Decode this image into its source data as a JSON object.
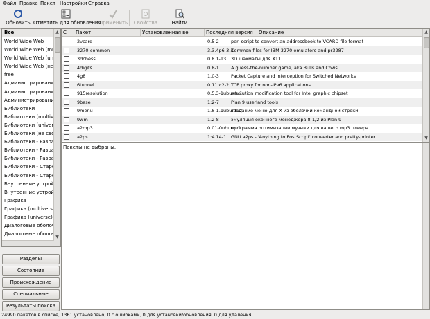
{
  "menu": [
    "Файл",
    "Правка",
    "Пакет",
    "Настройки",
    "Справка"
  ],
  "toolbar": {
    "reload": "Обновить",
    "mark_all_upgrades": "Отметить для обновления",
    "apply": "Применить",
    "properties": "Свойства",
    "search": "Найти"
  },
  "sections": {
    "header": "Все",
    "items": [
      "World Wide Web",
      "World Wide Web (multiv",
      "World Wide Web (univer",
      "World Wide Web (не сво",
      "free",
      "Администрирование",
      "Администрирование",
      "Администрирование",
      "Библиотеки",
      "Библиотеки (multiverse",
      "Библиотеки (universe",
      "Библиотеки (не свобо",
      "Библиотеки - Разрабо",
      "Библиотеки - Разрабо",
      "Библиотеки - Разрабо",
      "Библиотеки - Старое",
      "Библиотеки - Старое",
      "Внутренние устройст",
      "Внутренние устройст",
      "Графика",
      "Графика (multiverse)",
      "Графика (universe)",
      "Диалоговые оболочк",
      "Диалоговые оболочк",
      "Документация"
    ]
  },
  "filter_buttons": [
    "Разделы",
    "Состояние",
    "Происхождение",
    "Специальные фильтры",
    "Результаты поиска"
  ],
  "table": {
    "columns": [
      "С",
      "Пакет",
      "Установленная ве",
      "Последняя версия",
      "Описание"
    ],
    "rows": [
      {
        "name": "2vcard",
        "installed": "",
        "latest": "0.5-2",
        "description": "perl script to convert an addressbook to VCARD file format"
      },
      {
        "name": "3270-common",
        "installed": "",
        "latest": "3.3.4p6-3.3",
        "description": "Common files for IBM 3270 emulators and pr3287"
      },
      {
        "name": "3dchess",
        "installed": "",
        "latest": "0.8.1-13",
        "description": "3D шахматы для X11"
      },
      {
        "name": "4digits",
        "installed": "",
        "latest": "0.8-1",
        "description": "A guess-the-number game, aka Bulls and Cows"
      },
      {
        "name": "4g8",
        "installed": "",
        "latest": "1.0-3",
        "description": "Packet Capture and Interception for Switched Networks"
      },
      {
        "name": "6tunnel",
        "installed": "",
        "latest": "0.11rc2-2",
        "description": "TCP proxy for non-IPv6 applications"
      },
      {
        "name": "915resolution",
        "installed": "",
        "latest": "0.5.3-1ubuntu1",
        "description": "resolution modification tool for Intel graphic chipset"
      },
      {
        "name": "9base",
        "installed": "",
        "latest": "1:2-7",
        "description": "Plan 9 userland tools"
      },
      {
        "name": "9menu",
        "installed": "",
        "latest": "1.8-1.1ubuntu2",
        "description": "создание меню для X из оболочки командной строки"
      },
      {
        "name": "9wm",
        "installed": "",
        "latest": "1.2-8",
        "description": "эмуляция оконного менеджера 8-1/2 из Plan 9"
      },
      {
        "name": "a2mp3",
        "installed": "",
        "latest": "0.01-0ubuntu2",
        "description": "программа оптимизации музыки для вашего mp3 плеера"
      },
      {
        "name": "a2ps",
        "installed": "",
        "latest": "1:4.14-1",
        "description": "GNU a2ps - 'Anything to PostScript' converter and pretty-printer"
      }
    ]
  },
  "details": {
    "text": "Пакеты не выбраны."
  },
  "status": "24990 пакетов в списке, 1361 установлено, 0 с ошибками, 0 для установки/обновления, 0 для удаления",
  "colors": {
    "window_bg": "#edeceb",
    "row_alt": "#efefef",
    "border": "#8f8d88"
  }
}
